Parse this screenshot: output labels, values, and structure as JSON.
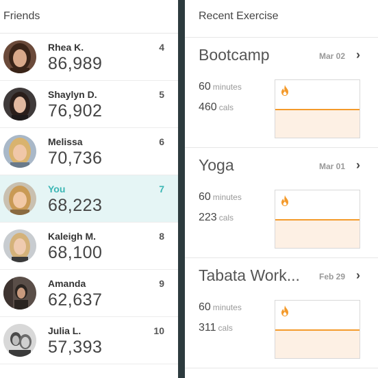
{
  "friends": {
    "title": "Friends",
    "items": [
      {
        "name": "Rhea K.",
        "steps": "86,989",
        "rank": "4",
        "avatar_bg": "#6b4a3a",
        "hair": "#3a2418",
        "skin": "#d9a98a"
      },
      {
        "name": "Shaylyn D.",
        "steps": "76,902",
        "rank": "5",
        "avatar_bg": "#3f3a3a",
        "hair": "#2a1e1a",
        "skin": "#e2b9a0"
      },
      {
        "name": "Melissa",
        "steps": "70,736",
        "rank": "6",
        "avatar_bg": "#a9b8c8",
        "hair": "#d9b36e",
        "skin": "#f0c7a8"
      },
      {
        "name": "You",
        "steps": "68,223",
        "rank": "7",
        "avatar_bg": "#c9c0b0",
        "hair": "#c99a55",
        "skin": "#f2c9a6"
      },
      {
        "name": "Kaleigh M.",
        "steps": "68,100",
        "rank": "8",
        "avatar_bg": "#c8ccd0",
        "hair": "#d4b27a",
        "skin": "#efcbb0"
      },
      {
        "name": "Amanda",
        "steps": "62,637",
        "rank": "9",
        "avatar_bg": "#5a4e48",
        "hair": "#2a2420",
        "skin": "#c89a7e"
      },
      {
        "name": "Julia L.",
        "steps": "57,393",
        "rank": "10",
        "avatar_bg": "#9a9a9a",
        "hair": "#4a4a4a",
        "skin": "#d8d8d8"
      }
    ]
  },
  "exercise": {
    "title": "Recent Exercise",
    "items": [
      {
        "name": "Bootcamp",
        "date": "Mar 02",
        "minutes": "60",
        "minutes_unit": "minutes",
        "cals": "460",
        "cals_unit": "cals"
      },
      {
        "name": "Yoga",
        "date": "Mar 01",
        "minutes": "60",
        "minutes_unit": "minutes",
        "cals": "223",
        "cals_unit": "cals"
      },
      {
        "name": "Tabata Work...",
        "date": "Feb 29",
        "minutes": "60",
        "minutes_unit": "minutes",
        "cals": "311",
        "cals_unit": "cals"
      }
    ],
    "chevron": "›"
  },
  "colors": {
    "accent": "#3bb6b4",
    "highlight_row": "#e5f5f5",
    "flame": "#f49a2a",
    "divider_bg": "#2d3b3e"
  }
}
